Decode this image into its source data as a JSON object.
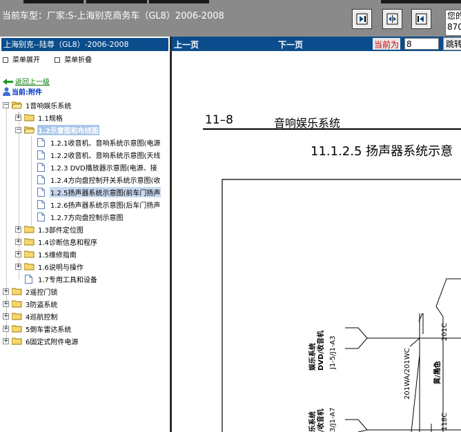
{
  "header": {
    "vehicle_label": "当前车型：",
    "vehicle_text": "厂家:S-上海别克商务车（GL8）2006-2008",
    "info_line1": "您的",
    "info_line2": "870"
  },
  "left_panel": {
    "title": "上海别克--陆尊（GL8）-2006-2008",
    "expand_all": "菜单展开",
    "collapse_all": "菜单折叠",
    "back_link": "返回上一级",
    "current_label": "当前:附件"
  },
  "tree": [
    {
      "label": "1音响娱乐系统"
    },
    {
      "label": "1.1规格"
    },
    {
      "label": "1.2示意图和布线图"
    },
    {
      "label": "1.2.1收音机、音响系统示意图(电源"
    },
    {
      "label": "1.2.2收音机、音响系统示意图(天线"
    },
    {
      "label": "1.2.3 DVD播放器示意图(电源、接"
    },
    {
      "label": "1.2.4方向盘控制开关系统示意图(收"
    },
    {
      "label": "1.2.5扬声器系统示意图(前车门扬声"
    },
    {
      "label": "1.2.6扬声器系统示意图(后车门扬声"
    },
    {
      "label": "1.2.7方向盘控制示意图"
    },
    {
      "label": "1.3部件定位图"
    },
    {
      "label": "1.4诊断信息和程序"
    },
    {
      "label": "1.5维修指南"
    },
    {
      "label": "1.6说明与操作"
    },
    {
      "label": "1.7专用工具和设备"
    },
    {
      "label": "2遥控门锁"
    },
    {
      "label": "3防盗系统"
    },
    {
      "label": "4巡航控制"
    },
    {
      "label": "5倒车雷达系统"
    },
    {
      "label": "6固定式附件电源"
    }
  ],
  "nav": {
    "prev": "上一页",
    "next": "下一页",
    "current_page_label": "当前为",
    "current_page_value": "8",
    "jump": "跳转"
  },
  "document": {
    "section_number": "11–8",
    "section_title": "音响娱乐系统",
    "diagram_title": "11.1.2.5 扬声器系统示意",
    "labels": {
      "dvd_module": "娱乐系统\nDVD/收音机",
      "dvd_connector": "J1-5/J1-A3",
      "wire_201wa": "201WA/201WC",
      "wire_201c": "201C",
      "wire_size_08": "0.8",
      "wire_color": "黄/黑色",
      "sys2_module": "乐系统\n/收音机",
      "sys2_connector": "3/J1-A7",
      "wire_118c": "118C"
    }
  },
  "icons": {
    "nav_buttons": [
      "sync-tree-icon",
      "tile-windows-icon",
      "close-frame-icon"
    ]
  }
}
